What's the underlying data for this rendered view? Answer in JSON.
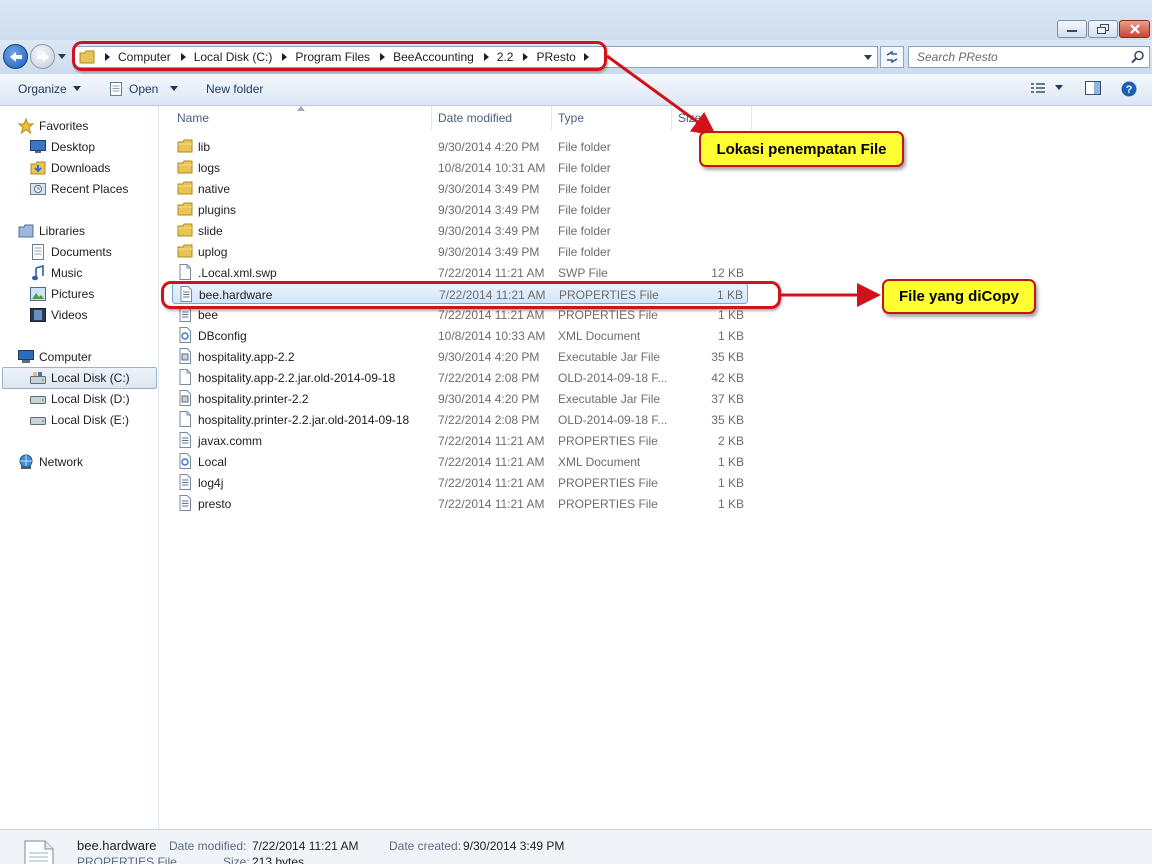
{
  "address": {
    "breadcrumbs": [
      "Computer",
      "Local Disk (C:)",
      "Program Files",
      "BeeAccounting",
      "2.2",
      "PResto"
    ],
    "search_placeholder": "Search PResto"
  },
  "toolbar": {
    "organize_label": "Organize",
    "open_label": "Open",
    "new_folder_label": "New folder"
  },
  "nav": {
    "favorites_label": "Favorites",
    "favorites": [
      "Desktop",
      "Downloads",
      "Recent Places"
    ],
    "libraries_label": "Libraries",
    "libraries": [
      "Documents",
      "Music",
      "Pictures",
      "Videos"
    ],
    "computer_label": "Computer",
    "drives": [
      "Local Disk (C:)",
      "Local Disk (D:)",
      "Local Disk (E:)"
    ],
    "network_label": "Network"
  },
  "columns": {
    "name": "Name",
    "date": "Date modified",
    "type": "Type",
    "size": "Size"
  },
  "files": [
    {
      "name": "lib",
      "date": "9/30/2014 4:20 PM",
      "type": "File folder",
      "size": "",
      "icon": "folder-icon"
    },
    {
      "name": "logs",
      "date": "10/8/2014 10:31 AM",
      "type": "File folder",
      "size": "",
      "icon": "folder-icon"
    },
    {
      "name": "native",
      "date": "9/30/2014 3:49 PM",
      "type": "File folder",
      "size": "",
      "icon": "folder-icon"
    },
    {
      "name": "plugins",
      "date": "9/30/2014 3:49 PM",
      "type": "File folder",
      "size": "",
      "icon": "folder-icon"
    },
    {
      "name": "slide",
      "date": "9/30/2014 3:49 PM",
      "type": "File folder",
      "size": "",
      "icon": "folder-icon"
    },
    {
      "name": "uplog",
      "date": "9/30/2014 3:49 PM",
      "type": "File folder",
      "size": "",
      "icon": "folder-icon"
    },
    {
      "name": ".Local.xml.swp",
      "date": "7/22/2014 11:21 AM",
      "type": "SWP File",
      "size": "12 KB",
      "icon": "blank-file-icon"
    },
    {
      "name": "bee.hardware",
      "date": "7/22/2014 11:21 AM",
      "type": "PROPERTIES File",
      "size": "1 KB",
      "icon": "text-file-icon"
    },
    {
      "name": "bee",
      "date": "7/22/2014 11:21 AM",
      "type": "PROPERTIES File",
      "size": "1 KB",
      "icon": "text-file-icon"
    },
    {
      "name": "DBconfig",
      "date": "10/8/2014 10:33 AM",
      "type": "XML Document",
      "size": "1 KB",
      "icon": "xml-file-icon"
    },
    {
      "name": "hospitality.app-2.2",
      "date": "9/30/2014 4:20 PM",
      "type": "Executable Jar File",
      "size": "35 KB",
      "icon": "jar-file-icon"
    },
    {
      "name": "hospitality.app-2.2.jar.old-2014-09-18",
      "date": "7/22/2014 2:08 PM",
      "type": "OLD-2014-09-18 F...",
      "size": "42 KB",
      "icon": "blank-file-icon"
    },
    {
      "name": "hospitality.printer-2.2",
      "date": "9/30/2014 4:20 PM",
      "type": "Executable Jar File",
      "size": "37 KB",
      "icon": "jar-file-icon"
    },
    {
      "name": "hospitality.printer-2.2.jar.old-2014-09-18",
      "date": "7/22/2014 2:08 PM",
      "type": "OLD-2014-09-18 F...",
      "size": "35 KB",
      "icon": "blank-file-icon"
    },
    {
      "name": "javax.comm",
      "date": "7/22/2014 11:21 AM",
      "type": "PROPERTIES File",
      "size": "2 KB",
      "icon": "text-file-icon"
    },
    {
      "name": "Local",
      "date": "7/22/2014 11:21 AM",
      "type": "XML Document",
      "size": "1 KB",
      "icon": "xml-file-icon"
    },
    {
      "name": "log4j",
      "date": "7/22/2014 11:21 AM",
      "type": "PROPERTIES File",
      "size": "1 KB",
      "icon": "text-file-icon"
    },
    {
      "name": "presto",
      "date": "7/22/2014 11:21 AM",
      "type": "PROPERTIES File",
      "size": "1 KB",
      "icon": "text-file-icon"
    }
  ],
  "selected_index": 7,
  "details": {
    "name": "bee.hardware",
    "type": "PROPERTIES File",
    "modified_label": "Date modified:",
    "modified": "7/22/2014 11:21 AM",
    "created_label": "Date created:",
    "created": "9/30/2014 3:49 PM",
    "size_label": "Size:",
    "size": "213 bytes"
  },
  "annotations": {
    "location_label": "Lokasi penempatan File",
    "copied_label": "File yang diCopy"
  },
  "colors": {
    "annotation_fill": "#ffff33",
    "annotation_border": "#c0141b",
    "selection": "#d3e5fa"
  }
}
